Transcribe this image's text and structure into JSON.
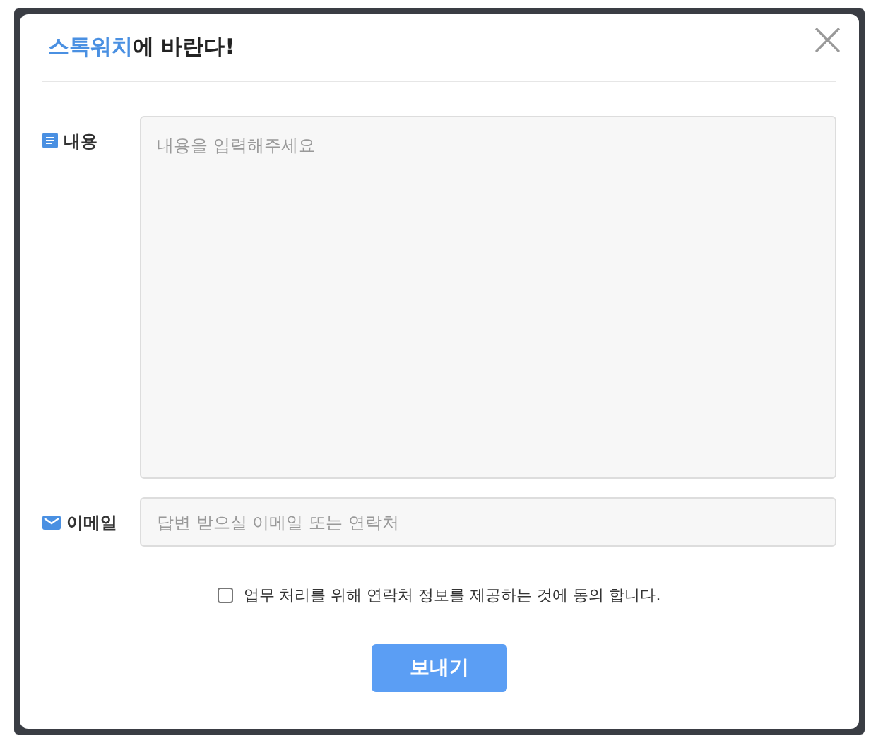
{
  "dialog": {
    "title_highlight": "스톡워치",
    "title_rest": "에 바란다!",
    "close": "×"
  },
  "fields": [
    {
      "kind": "textarea",
      "label": "내용",
      "placeholder": "내용을 입력해주세요"
    },
    {
      "kind": "input",
      "label": "이메일",
      "placeholder": "답변 받으실 이메일 또는 연락처"
    }
  ],
  "consent": {
    "label": "업무 처리를 위해 연락처 정보를 제공하는 것에 동의 합니다.",
    "checked": false
  },
  "submit": "보내기"
}
